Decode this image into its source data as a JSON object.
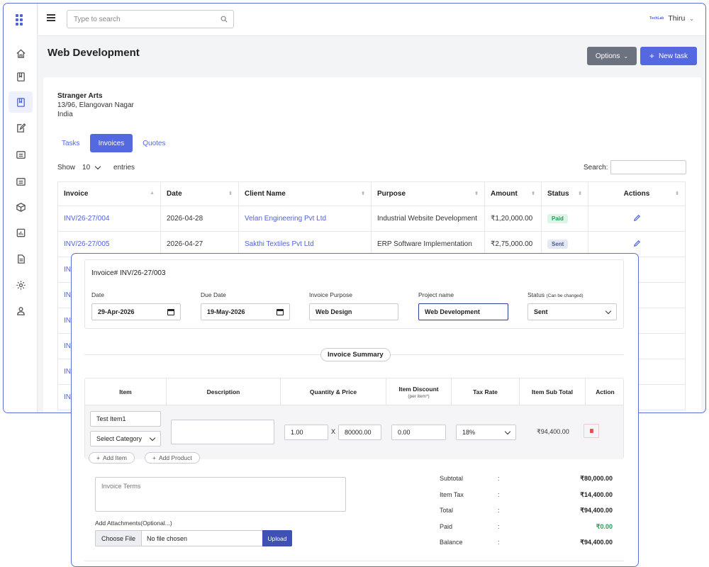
{
  "topbar": {
    "search_placeholder": "Type to search",
    "user_name": "Thiru",
    "user_logo_text": "TechLab"
  },
  "page": {
    "title": "Web Development",
    "options_label": "Options",
    "new_task_label": "New task"
  },
  "client": {
    "name": "Stranger Arts",
    "address_line1": "13/96, Elangovan Nagar",
    "country": "India"
  },
  "tabs": [
    "Tasks",
    "Invoices",
    "Quotes"
  ],
  "active_tab": "Invoices",
  "table_controls": {
    "show_label": "Show",
    "entries_value": "10",
    "entries_label": "entries",
    "search_label": "Search:"
  },
  "invoice_table": {
    "columns": [
      "Invoice",
      "Date",
      "Client Name",
      "Purpose",
      "Amount",
      "Status",
      "Actions"
    ],
    "rows": [
      {
        "invoice": "INV/26-27/004",
        "date": "2026-04-28",
        "client": "Velan Engineering Pvt Ltd",
        "purpose": "Industrial Website Development",
        "amount": "₹1,20,000.00",
        "status": "Paid"
      },
      {
        "invoice": "INV/26-27/005",
        "date": "2026-04-27",
        "client": "Sakthi Textiles Pvt Ltd",
        "purpose": "ERP Software Implementation",
        "amount": "₹2,75,000.00",
        "status": "Sent"
      },
      {
        "invoice": "IN"
      },
      {
        "invoice": "IN"
      },
      {
        "invoice": "IN"
      },
      {
        "invoice": "IN"
      },
      {
        "invoice": "IN"
      },
      {
        "invoice": "IN"
      }
    ]
  },
  "invoice_form": {
    "invoice_number": "Invoice# INV/26-27/003",
    "date_label": "Date",
    "date_value": "29-Apr-2026",
    "due_date_label": "Due Date",
    "due_date_value": "19-May-2026",
    "purpose_label": "Invoice Purpose",
    "purpose_value": "Web Design",
    "project_label": "Project name",
    "project_value": "Web Development",
    "status_label": "Status",
    "status_hint": "(Can be changed)",
    "status_value": "Sent",
    "summary_label": "Invoice Summary"
  },
  "items_table": {
    "headers": {
      "item": "Item",
      "description": "Description",
      "qty_price": "Quantity & Price",
      "discount": "Item Discount",
      "discount_hint": "(per item*)",
      "tax": "Tax Rate",
      "subtotal": "Item Sub Total",
      "action": "Action"
    },
    "row": {
      "item_name": "Test Item1",
      "category": "Select Category",
      "quantity": "1.00",
      "times": "X",
      "price": "80000.00",
      "discount": "0.00",
      "tax_rate": "18%",
      "sub_total": "₹94,400.00"
    },
    "add_item_label": "Add Item",
    "add_product_label": "Add Product"
  },
  "footer": {
    "terms_placeholder": "Invoice Terms",
    "attachments_label": "Add Attachments(Optional...)",
    "choose_file_label": "Choose File",
    "no_file_label": "No file chosen",
    "upload_label": "Upload"
  },
  "totals": [
    {
      "label": "Subtotal",
      "value": "₹80,000.00"
    },
    {
      "label": "Item Tax",
      "value": "₹14,400.00"
    },
    {
      "label": "Total",
      "value": "₹94,400.00"
    },
    {
      "label": "Paid",
      "value": "₹0.00"
    },
    {
      "label": "Balance",
      "value": "₹94,400.00"
    }
  ],
  "colors": {
    "accent": "#5468e0",
    "paid_badge": "#1f9d55",
    "sent_badge": "#4b5a8a",
    "delete": "#e05555"
  }
}
